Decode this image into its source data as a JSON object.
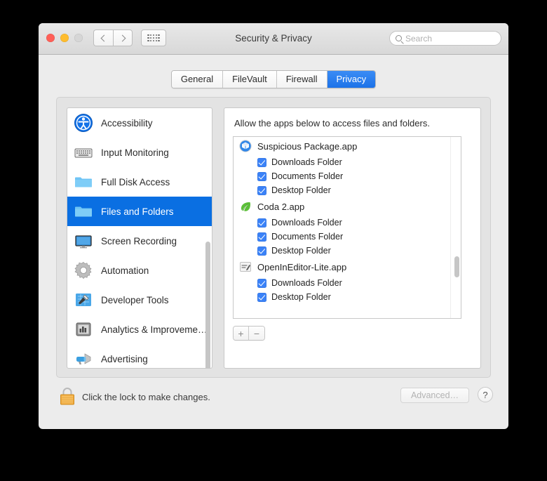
{
  "window": {
    "title": "Security & Privacy",
    "traffic_lights": [
      "close",
      "minimize",
      "zoom"
    ],
    "nav_back": "back-icon",
    "nav_forward": "forward-icon",
    "show_all": "grid-icon"
  },
  "search": {
    "placeholder": "Search",
    "value": "",
    "icon": "search-icon"
  },
  "tabs": [
    {
      "label": "General",
      "active": false
    },
    {
      "label": "FileVault",
      "active": false
    },
    {
      "label": "Firewall",
      "active": false
    },
    {
      "label": "Privacy",
      "active": true
    }
  ],
  "sidebar": {
    "items": [
      {
        "label": "Accessibility",
        "icon": "accessibility-icon",
        "selected": false
      },
      {
        "label": "Input Monitoring",
        "icon": "keyboard-icon",
        "selected": false
      },
      {
        "label": "Full Disk Access",
        "icon": "folder-icon",
        "selected": false
      },
      {
        "label": "Files and Folders",
        "icon": "folder-icon",
        "selected": true
      },
      {
        "label": "Screen Recording",
        "icon": "display-icon",
        "selected": false
      },
      {
        "label": "Automation",
        "icon": "gear-icon",
        "selected": false
      },
      {
        "label": "Developer Tools",
        "icon": "hammer-blueprint-icon",
        "selected": false
      },
      {
        "label": "Analytics & Improveme…",
        "icon": "bar-chart-icon",
        "selected": false
      },
      {
        "label": "Advertising",
        "icon": "megaphone-icon",
        "selected": false
      }
    ]
  },
  "main": {
    "description": "Allow the apps below to access files and folders.",
    "apps": [
      {
        "name": "Suspicious Package.app",
        "icon": "suspicious-package-icon",
        "permissions": [
          {
            "label": "Downloads Folder",
            "checked": true
          },
          {
            "label": "Documents Folder",
            "checked": true
          },
          {
            "label": "Desktop Folder",
            "checked": true
          }
        ]
      },
      {
        "name": "Coda 2.app",
        "icon": "coda-leaf-icon",
        "permissions": [
          {
            "label": "Downloads Folder",
            "checked": true
          },
          {
            "label": "Documents Folder",
            "checked": true
          },
          {
            "label": "Desktop Folder",
            "checked": true
          }
        ]
      },
      {
        "name": "OpenInEditor-Lite.app",
        "icon": "editor-document-icon",
        "permissions": [
          {
            "label": "Downloads Folder",
            "checked": true
          },
          {
            "label": "Desktop Folder",
            "checked": true
          }
        ]
      }
    ],
    "add_label": "+",
    "remove_label": "−"
  },
  "footer": {
    "lock_icon": "lock-closed-icon",
    "lock_text": "Click the lock to make changes.",
    "advanced_label": "Advanced…",
    "help_label": "?"
  },
  "colors": {
    "accent": "#0a6fe2",
    "tab_active": "#2b7de9",
    "checkbox": "#3b82f7",
    "window_bg": "#ececec"
  }
}
